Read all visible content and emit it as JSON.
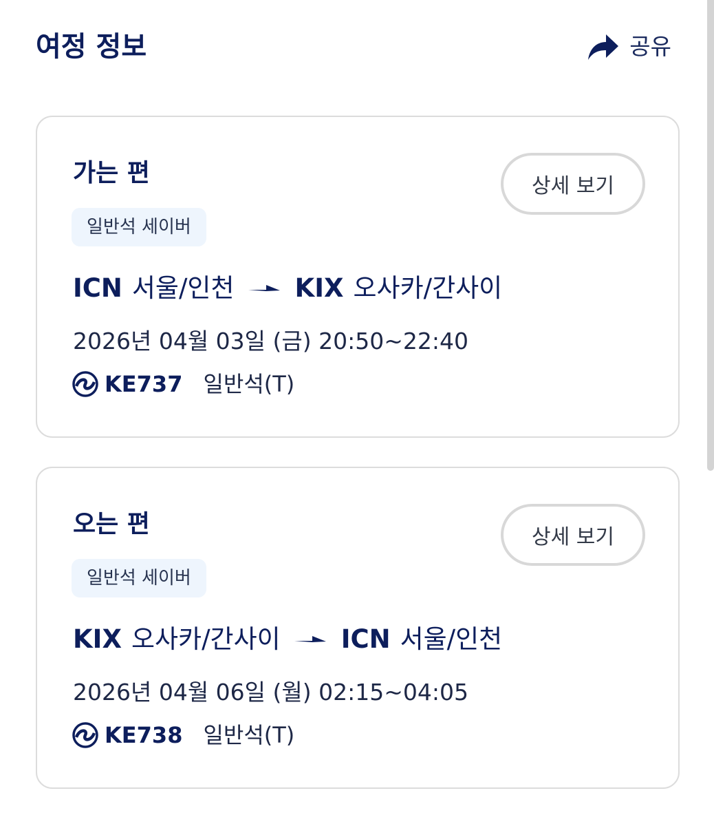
{
  "header": {
    "title": "여정 정보",
    "share_label": "공유"
  },
  "legs": [
    {
      "title": "가는 편",
      "detail_label": "상세 보기",
      "cabin_badge": "일반석 세이버",
      "origin_code": "ICN",
      "origin_name": "서울/인천",
      "dest_code": "KIX",
      "dest_name": "오사카/간사이",
      "datetime": "2026년 04월 03일 (금)  20:50~22:40",
      "flight_no": "KE737",
      "seat_class": "일반석(T)"
    },
    {
      "title": "오는 편",
      "detail_label": "상세 보기",
      "cabin_badge": "일반석 세이버",
      "origin_code": "KIX",
      "origin_name": "오사카/간사이",
      "dest_code": "ICN",
      "dest_name": "서울/인천",
      "datetime": "2026년 04월 06일 (월)  02:15~04:05",
      "flight_no": "KE738",
      "seat_class": "일반석(T)"
    }
  ],
  "icons": {
    "share": "share-arrow-icon",
    "route_arrow": "flight-arrow-icon",
    "airline": "korean-air-logo-icon"
  },
  "colors": {
    "primary_navy": "#0d1e5c",
    "badge_bg": "#eef5fd",
    "card_border": "#dcdcdc",
    "button_border": "#d8d8d8"
  }
}
